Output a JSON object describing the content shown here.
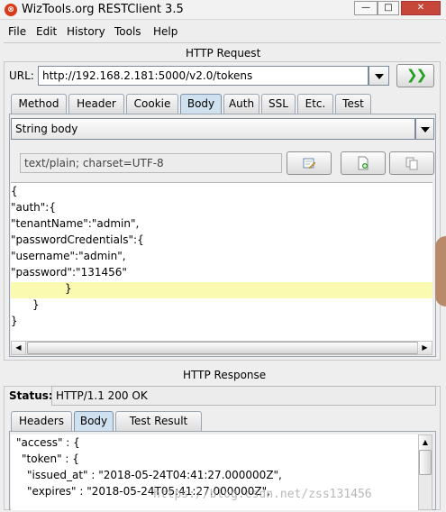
{
  "window": {
    "title": "WizTools.org RESTClient 3.5",
    "icon": "wiztools-app-icon"
  },
  "menu": [
    "File",
    "Edit",
    "History",
    "Tools",
    "Help"
  ],
  "request": {
    "section_title": "HTTP Request",
    "url_label": "URL:",
    "url": "http://192.168.2.181:5000/v2.0/tokens",
    "go_icon": "double-chevron-right-icon",
    "tabs": [
      "Method",
      "Header",
      "Cookie",
      "Body",
      "Auth",
      "SSL",
      "Etc.",
      "Test"
    ],
    "active_tab": "Body",
    "body_type": "String body",
    "content_type": "text/plain; charset=UTF-8",
    "body_lines": [
      "{",
      "\"auth\":{",
      "\"tenantName\":\"admin\",",
      "\"passwordCredentials\":{",
      "\"username\":\"admin\",",
      "\"password\":\"131456\"",
      "}",
      "}",
      "}"
    ]
  },
  "response": {
    "section_title": "HTTP Response",
    "status_label": "Status:",
    "status": "HTTP/1.1 200 OK",
    "tabs": [
      "Headers",
      "Body",
      "Test Result"
    ],
    "active_tab": "Body",
    "body_lines": [
      "\"access\" : {",
      "\"token\" : {",
      "\"issued_at\" : \"2018-05-24T04:41:27.000000Z\",",
      "\"expires\" : \"2018-05-24T05:41:27.000000Z\","
    ]
  },
  "watermark": "https://blog.csdn.net/zss131456"
}
